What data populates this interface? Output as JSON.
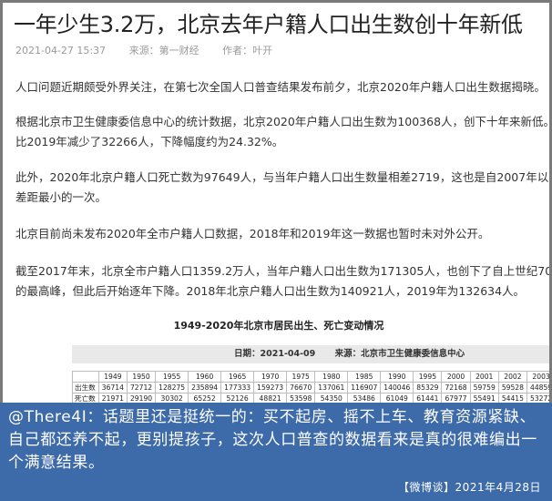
{
  "article": {
    "title": "一年少生3.2万，北京去年户籍人口出生数创十年新低",
    "date": "2021-04-27 15:37",
    "source": "来源：第一财经",
    "author": "作者：叶开",
    "paragraphs": [
      [
        "人口问题近期颇受外界关注，在第七次全国人口普查结果发布前夕，北京2020年户籍人口出生数据揭晓。"
      ],
      [
        "根据北京市卫生健康委信息中心的统计数据，北京2020年户籍人口出生数为100368人，创下十年来新低。",
        "比2019年减少了32266人，下降幅度约为24.32%。"
      ],
      [
        "此外，2020年北京户籍人口死亡数为97649人，与当年户籍人口出生数量相差2719，这也是自2007年以来",
        "差距最小的一次。"
      ],
      [
        "北京目前尚未发布2020年全市户籍人口数据，2018年和2019年这一数据也暂时未对外公开。"
      ],
      [
        "截至2017年末，北京全市户籍人口1359.2万人，当年户籍人口出生数为171305人，也创下了自上世纪70年",
        "的最高峰，但此后开始逐年下降。2018年北京户籍人口出生数为140921人，2019年为132634人。"
      ]
    ]
  },
  "table": {
    "title": "1949-2020年北京市居民出生、死亡变动情况",
    "date_label": "日期：2021-04-09",
    "source_label": "来源：北京市卫生健康委信息中心",
    "years": [
      "1949",
      "1950",
      "1955",
      "1960",
      "1965",
      "1970",
      "1975",
      "1980",
      "1985",
      "1990",
      "1995",
      "2000",
      "2001",
      "2002",
      "2003",
      "2004",
      "2005"
    ],
    "rows": [
      {
        "label": "出生数",
        "values": [
          "36714",
          "72712",
          "128275",
          "235894",
          "177333",
          "159273",
          "76670",
          "137061",
          "116907",
          "140046",
          "85329",
          "72168",
          "59759",
          "59528",
          "44859",
          "52681",
          "58409"
        ]
      },
      {
        "label": "死亡数",
        "values": [
          "21971",
          "29190",
          "30302",
          "65252",
          "52126",
          "48821",
          "53598",
          "54350",
          "53486",
          "61049",
          "61441",
          "67977",
          "55491",
          "54415",
          "53272",
          "53291",
          "63696"
        ]
      }
    ]
  },
  "overlay": {
    "comment": "@There4I：话题里还是挺统一的：买不起房、摇不上车、教育资源紧缺、自己都还养不起，更别提孩子，这次人口普查的数据看来是真的很难编出一个满意结果。",
    "tag": "【微博谈】2021年4月28日"
  }
}
